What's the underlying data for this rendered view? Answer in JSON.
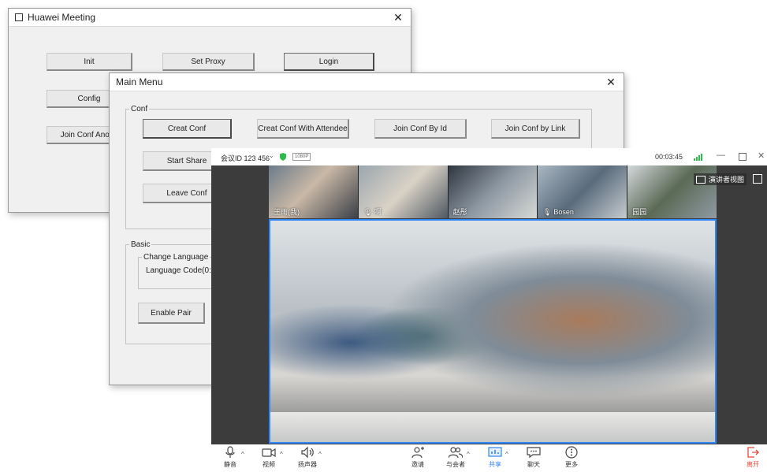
{
  "win1": {
    "title": "Huawei Meeting",
    "buttons": {
      "init": "Init",
      "set_proxy": "Set Proxy",
      "login": "Login",
      "config": "Config",
      "join_anon": "Join Conf Anony"
    }
  },
  "win2": {
    "title": "Main Menu",
    "conf_group": "Conf",
    "buttons": {
      "creat_conf": "Creat Conf",
      "creat_attendee": "Creat Conf With Attendee",
      "join_by_id": "Join Conf By Id",
      "join_by_link": "Join Conf by Link",
      "start_share": "Start Share",
      "leave_conf": "Leave Conf",
      "enable_pair": "Enable Pair"
    },
    "basic_group": "Basic",
    "change_language_group": "Change Language",
    "language_code_label": "Language Code(0: Chin"
  },
  "meeting": {
    "conf_id": "会议ID 123 456",
    "quality_badge": "1080P",
    "timer": "00:03:45",
    "speaker_view": "演讲者视图",
    "participants": [
      "王雨(我)",
      "啊",
      "赵彤",
      "Bosen",
      "园园"
    ],
    "toolbar": {
      "mute": "静音",
      "video": "视频",
      "speaker": "扬声器",
      "invite": "邀请",
      "participants": "与会者",
      "share": "共享",
      "chat": "聊天",
      "more": "更多",
      "leave": "离开"
    },
    "colors": {
      "accent": "#2f86f6",
      "leave": "#e8463a",
      "secure": "#2dbb4b"
    }
  }
}
